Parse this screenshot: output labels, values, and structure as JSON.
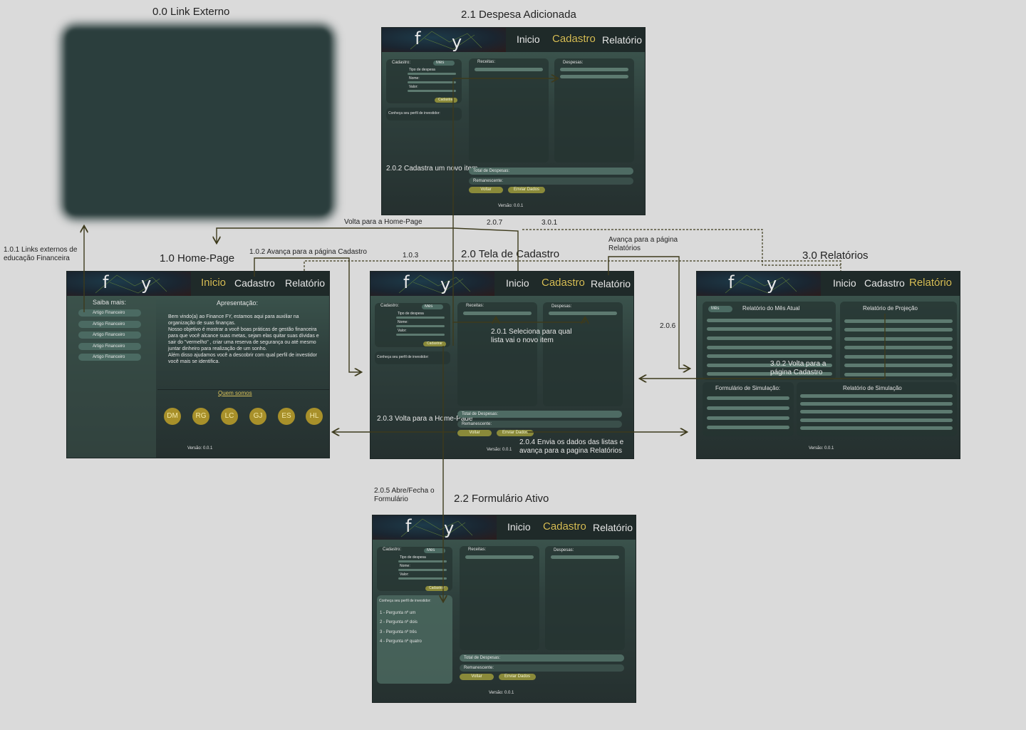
{
  "titles": {
    "link_externo": "0.0 Link Externo",
    "despesa_adicionada": "2.1 Despesa Adicionada",
    "home_page": "1.0 Home-Page",
    "tela_cadastro": "2.0 Tela de Cadastro",
    "relatorios": "3.0 Relatórios",
    "formulario_ativo": "2.2 Formulário Ativo"
  },
  "notes": {
    "links_externos": "1.0.1 Links externos de\neducação Financeira",
    "avanca_cadastro": "1.0.2 Avança para a página Cadastro",
    "n103": "1.0.3",
    "volta_home": "Volta para a Home-Page",
    "n207": "2.0.7",
    "n301": "3.0.1",
    "avanca_relatorios": "Avança para a página\nRelatórios",
    "n206": "2.0.6",
    "abre_fecha": "2.0.5 Abre/Fecha o\nFormulário"
  },
  "nav": {
    "inicio": "Inicio",
    "cadastro": "Cadastro",
    "relatorio": "Relatório"
  },
  "logo": {
    "f": "f",
    "y": "y"
  },
  "cadastro_form": {
    "cadastro_label": "Cadastro:",
    "mes": "Mês",
    "tipo_despesa": "Tipo de despesa",
    "nome": "Nome:",
    "valor": "Valor:",
    "cadastrar": "Cadastrar",
    "conheca": "Conheça seu perfil de investidor:",
    "receitas": "Receitas:",
    "despesas": "Despesas:",
    "total_despesas": "Total de Despesas:",
    "remanescente": "Remanescente:",
    "voltar": "Voltar",
    "enviar": "Enviar Dados",
    "versao": "Versão: 0.0.1"
  },
  "screen21_annotation": "2.0.2 Cadastra um\nnovo item",
  "screen20_annotations": {
    "seleciona": "2.0.1 Seleciona para qual\nlista vai o novo item",
    "volta_home": "2.0.3 Volta para a\nHome-Page",
    "envia": "2.0.4 Envia os dados das listas e\navança para a pagina Relatórios"
  },
  "home": {
    "saiba_mais": "Saiba mais:",
    "artigos": [
      "Artigo Financeiro",
      "Artigo Financeiro",
      "Artigo Financeiro",
      "Artigo Financeiro",
      "Artigo Financeiro"
    ],
    "apresentacao_title": "Apresentação:",
    "apresentacao_text": "Bem vindo(a) ao Finance FY, estamos aqui para auxiliar na organização de suas finanças.\n Nosso objetivo é mostrar a você boas práticas de gestão financeira para que você alcance suas metas, sejam elas quitar suas dívidas e sair do \"vermelho\" , criar uma reserva de segurança ou até mesmo juntar dinheiro para realização de um sonho.\n Além disso ajudamos você a descobrir com qual perfil de investidor você mais se identifica.",
    "quem_somos": "Quem somos",
    "members": [
      "DM",
      "RG",
      "LC",
      "GJ",
      "ES",
      "HL"
    ],
    "versao": "Versão: 0.0.1"
  },
  "relatorios": {
    "mes": "Mês",
    "relatorio_mes": "Relatório do Mês Atual",
    "relatorio_projecao": "Relatório de Projeção",
    "formulario_simulacao": "Formulário de Simulação:",
    "relatorio_simulacao": "Relatório de Simulação",
    "volta_cadastro": "3.0.2 Volta para a\npágina Cadastro",
    "versao": "Versão: 0.0.1"
  },
  "formulario": {
    "perguntas": [
      "1 - Pergunta nº um",
      "2 - Pergunta nº dois",
      "3 - Pergunta nº três",
      "4 - Pergunta nº quatro"
    ]
  },
  "colors": {
    "arrow": "#3d3a1c",
    "accent": "#d9c25a",
    "circle": "#a8902a"
  }
}
